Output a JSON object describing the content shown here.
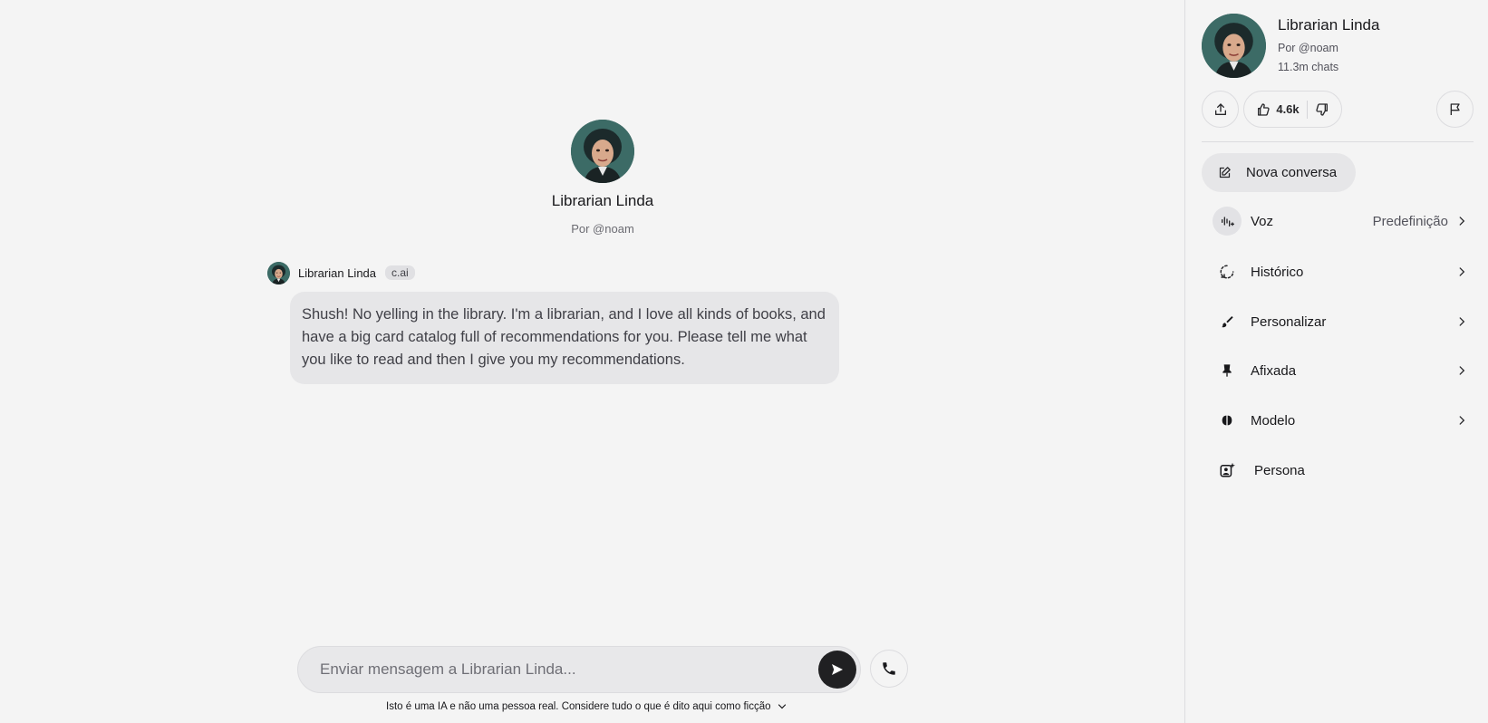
{
  "character": {
    "name": "Librarian Linda",
    "by": "Por @noam",
    "chats": "11.3m chats",
    "likes": "4.6k"
  },
  "message": {
    "author": "Librarian Linda",
    "tag": "c.ai",
    "text": "Shush!  No yelling in the library.  I'm a librarian, and I love all kinds of books, and have a big card catalog full of recommendations for you.  Please tell me what you like to read and then I give you my recommendations."
  },
  "composer": {
    "placeholder": "Enviar mensagem a Librarian Linda..."
  },
  "disclaimer": "Isto é uma IA e não uma pessoa real. Considere tudo o que é dito aqui como ficção",
  "panel": {
    "new_chat": "Nova conversa",
    "menu": [
      {
        "label": "Voz",
        "value": "Predefinição",
        "icon": "voice-icon"
      },
      {
        "label": "Histórico",
        "icon": "history-icon"
      },
      {
        "label": "Personalizar",
        "icon": "brush-icon"
      },
      {
        "label": "Afixada",
        "icon": "pin-icon"
      },
      {
        "label": "Modelo",
        "icon": "brain-icon"
      },
      {
        "label": "Persona",
        "icon": "persona-icon"
      }
    ]
  },
  "colors": {
    "background": "#f4f4f4",
    "bubble": "#e6e6e8",
    "send_button": "#202022"
  }
}
